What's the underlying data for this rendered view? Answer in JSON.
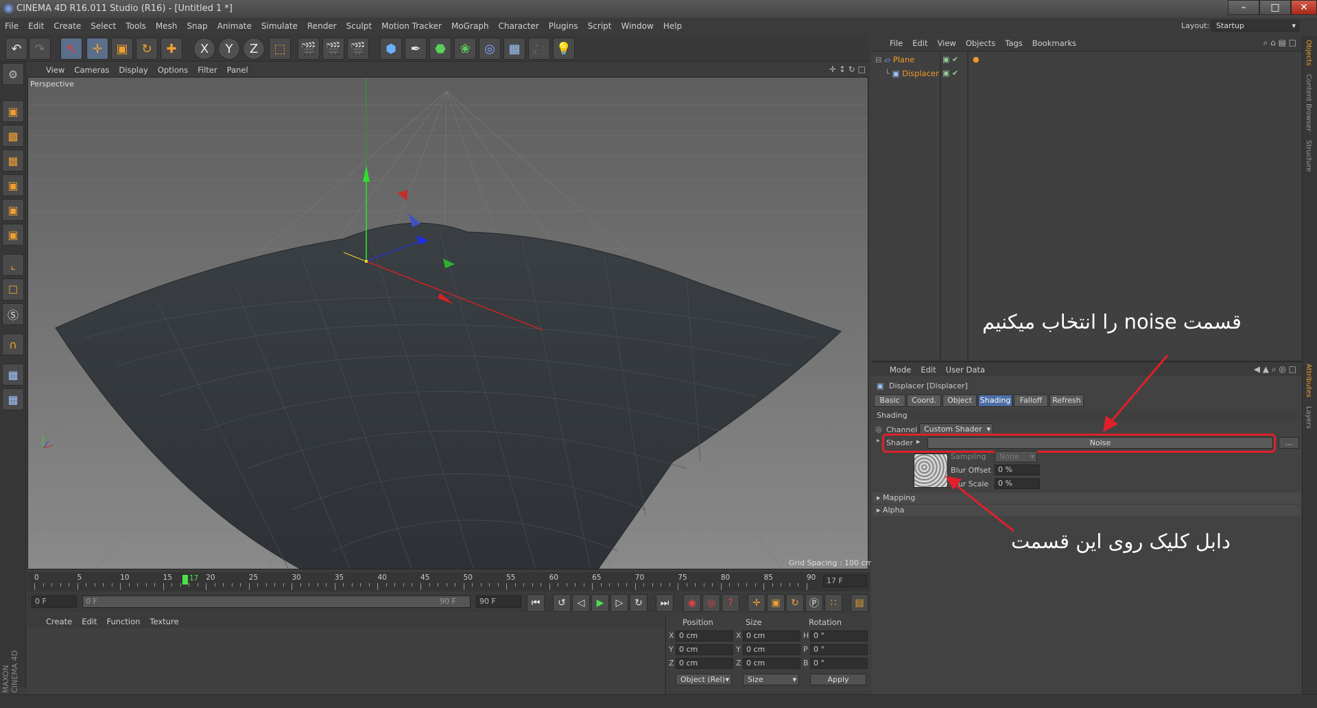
{
  "window": {
    "title": "CINEMA 4D R16.011 Studio (R16) - [Untitled 1 *]",
    "layout_label": "Layout:",
    "layout_value": "Startup"
  },
  "menubar": [
    "File",
    "Edit",
    "Create",
    "Select",
    "Tools",
    "Mesh",
    "Snap",
    "Animate",
    "Simulate",
    "Render",
    "Sculpt",
    "Motion Tracker",
    "MoGraph",
    "Character",
    "Plugins",
    "Script",
    "Window",
    "Help"
  ],
  "toolbar": {
    "axis_x": "X",
    "axis_y": "Y",
    "axis_z": "Z"
  },
  "viewport": {
    "menu": [
      "View",
      "Cameras",
      "Display",
      "Options",
      "Filter",
      "Panel"
    ],
    "label": "Perspective",
    "grid_spacing": "Grid Spacing : 100 cm"
  },
  "timeline": {
    "ticks": [
      "0",
      "5",
      "10",
      "15",
      "20",
      "25",
      "30",
      "35",
      "40",
      "45",
      "50",
      "55",
      "60",
      "65",
      "70",
      "75",
      "80",
      "85",
      "90"
    ],
    "current_frame_marker": "17",
    "current_frame_field": "17 F",
    "start_field": "0 F",
    "range_start": "0 F",
    "range_end": "90 F",
    "end_field": "90 F"
  },
  "material_panel": {
    "menu": [
      "Create",
      "Edit",
      "Function",
      "Texture"
    ],
    "brand": "MAXON CINEMA 4D"
  },
  "coord_manager": {
    "headers": [
      "Position",
      "Size",
      "Rotation"
    ],
    "rows": [
      {
        "pos_axis": "X",
        "pos": "0 cm",
        "size_axis": "X",
        "size": "0 cm",
        "rot_axis": "H",
        "rot": "0 °"
      },
      {
        "pos_axis": "Y",
        "pos": "0 cm",
        "size_axis": "Y",
        "size": "0 cm",
        "rot_axis": "P",
        "rot": "0 °"
      },
      {
        "pos_axis": "Z",
        "pos": "0 cm",
        "size_axis": "Z",
        "size": "0 cm",
        "rot_axis": "B",
        "rot": "0 °"
      }
    ],
    "mode_dropdown": "Object (Rel)",
    "size_dropdown": "Size",
    "apply_button": "Apply"
  },
  "object_manager": {
    "menu": [
      "File",
      "Edit",
      "View",
      "Objects",
      "Tags",
      "Bookmarks"
    ],
    "objects": [
      {
        "name": "Plane"
      },
      {
        "name": "Displacer"
      }
    ]
  },
  "attributes": {
    "menu": [
      "Mode",
      "Edit",
      "User Data"
    ],
    "object_title": "Displacer [Displacer]",
    "tabs": [
      "Basic",
      "Coord.",
      "Object",
      "Shading",
      "Falloff",
      "Refresh"
    ],
    "active_tab": "Shading",
    "section": "Shading",
    "channel_label": "Channel",
    "channel_value": "Custom Shader",
    "shader_label": "Shader",
    "shader_value": "Noise",
    "shader_more": "...",
    "sampling_label": "Sampling",
    "sampling_value": "None",
    "blur_offset_label": "Blur Offset",
    "blur_offset_value": "0 %",
    "blur_scale_label": "Blur Scale",
    "blur_scale_value": "0 %",
    "mapping_section": "Mapping",
    "alpha_section": "Alpha"
  },
  "side_tabs": {
    "top": [
      "Objects",
      "Content Browser",
      "Structure"
    ],
    "bottom": [
      "Attributes",
      "Layers"
    ]
  },
  "annotations": {
    "top_note": "قسمت noise را انتخاب میکنیم",
    "bottom_note": "دابل کلیک روی این قسمت"
  },
  "colors": {
    "accent_orange": "#f09a2a",
    "active_tab": "#4b6ea5",
    "highlight_red": "#e0202a"
  }
}
